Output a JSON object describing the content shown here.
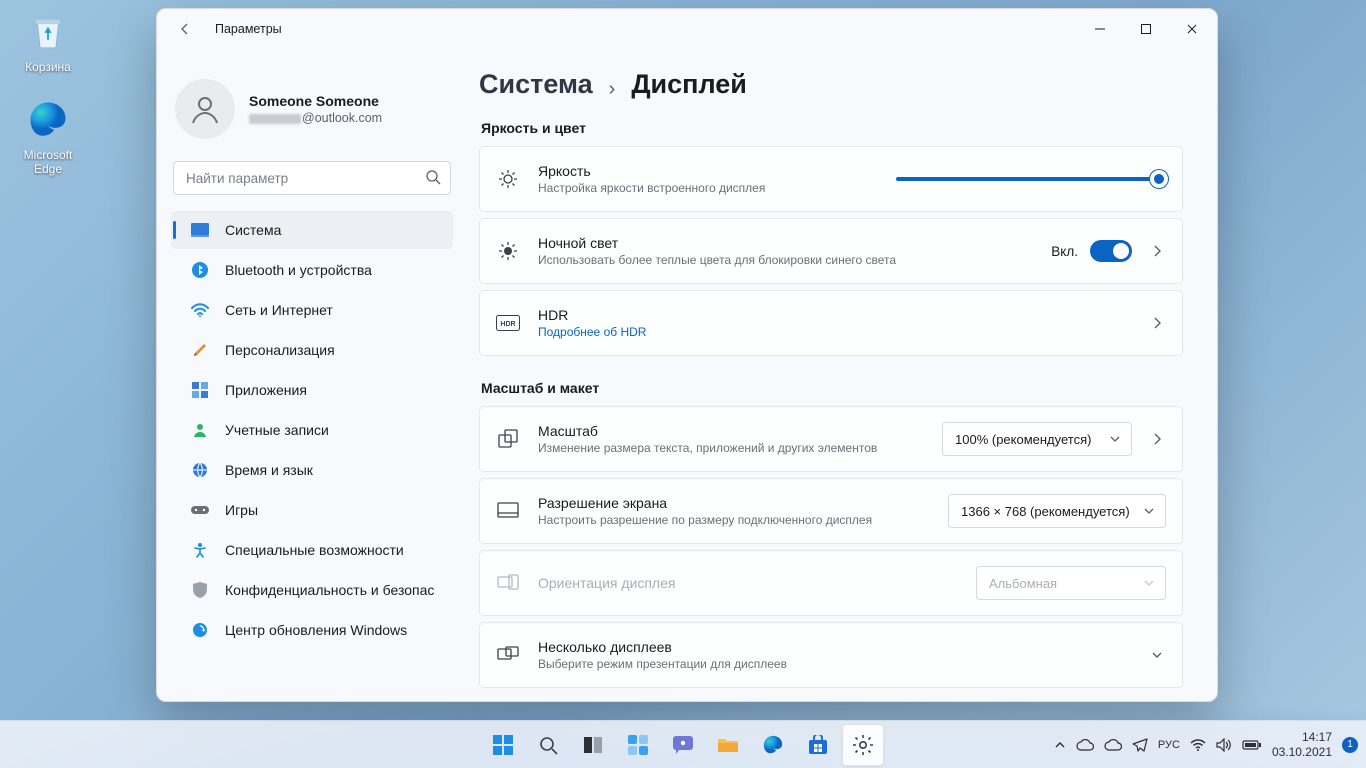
{
  "desktop": {
    "icons": [
      {
        "label": "Корзина"
      },
      {
        "label": "Microsoft Edge"
      }
    ]
  },
  "window": {
    "title": "Параметры"
  },
  "profile": {
    "name": "Someone Someone",
    "email_suffix": "@outlook.com"
  },
  "search": {
    "placeholder": "Найти параметр"
  },
  "nav": {
    "items": [
      {
        "label": "Система"
      },
      {
        "label": "Bluetooth и устройства"
      },
      {
        "label": "Сеть и Интернет"
      },
      {
        "label": "Персонализация"
      },
      {
        "label": "Приложения"
      },
      {
        "label": "Учетные записи"
      },
      {
        "label": "Время и язык"
      },
      {
        "label": "Игры"
      },
      {
        "label": "Специальные возможности"
      },
      {
        "label": "Конфиденциальность и безопасность"
      },
      {
        "label": "Центр обновления Windows"
      }
    ]
  },
  "breadcrumb": {
    "parent": "Система",
    "page": "Дисплей"
  },
  "sections": {
    "brightness_color": "Яркость и цвет",
    "scale_layout": "Масштаб и макет"
  },
  "rows": {
    "brightness": {
      "title": "Яркость",
      "sub": "Настройка яркости встроенного дисплея",
      "value_pct": 100
    },
    "night_light": {
      "title": "Ночной свет",
      "sub": "Использовать более теплые цвета для блокировки синего света",
      "state_label": "Вкл.",
      "on": true
    },
    "hdr": {
      "title": "HDR",
      "sub": "Подробнее об HDR"
    },
    "scale": {
      "title": "Масштаб",
      "sub": "Изменение размера текста, приложений и других элементов",
      "value": "100% (рекомендуется)"
    },
    "resolution": {
      "title": "Разрешение экрана",
      "sub": "Настроить разрешение по размеру подключенного дисплея",
      "value": "1366 × 768 (рекомендуется)"
    },
    "orientation": {
      "title": "Ориентация дисплея",
      "value": "Альбомная",
      "disabled": true
    },
    "multi": {
      "title": "Несколько дисплеев",
      "sub": "Выберите режим презентации для дисплеев"
    }
  },
  "taskbar": {
    "lang": "РУС",
    "time": "14:17",
    "date": "03.10.2021",
    "notif_count": "1"
  }
}
